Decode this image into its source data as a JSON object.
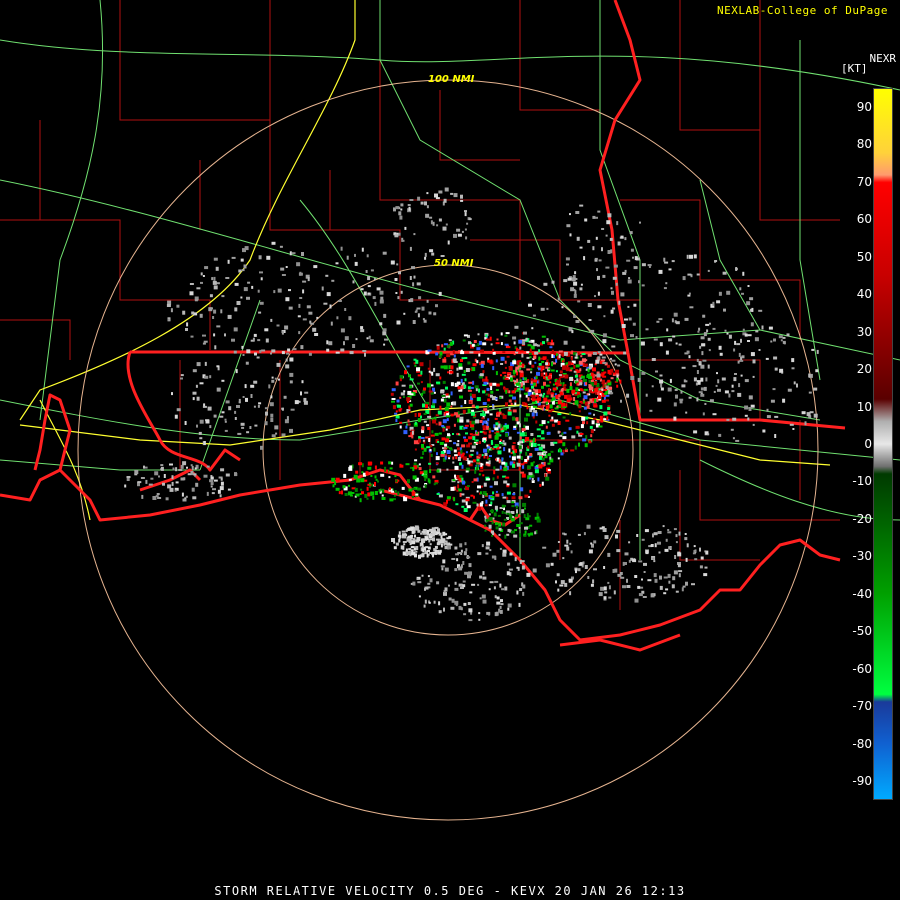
{
  "header": {
    "credit": "NEXLAB-College of DuPage",
    "product": "NEXR",
    "units": "[KT]"
  },
  "rings": {
    "outer_label": "100 NMI",
    "inner_label": "50 NMI"
  },
  "colorbar": {
    "ticks": [
      90,
      80,
      70,
      60,
      50,
      40,
      30,
      20,
      10,
      0,
      -10,
      -20,
      -30,
      -40,
      -50,
      -60,
      -70,
      -80,
      -90
    ],
    "range": [
      -95,
      95
    ],
    "stops": [
      {
        "v": 95,
        "color": "#ffff00"
      },
      {
        "v": 78,
        "color": "#ffd23a"
      },
      {
        "v": 72,
        "color": "#ff9a6e"
      },
      {
        "v": 70,
        "color": "#ff0000"
      },
      {
        "v": 45,
        "color": "#c80000"
      },
      {
        "v": 12,
        "color": "#5a0000"
      },
      {
        "v": 6,
        "color": "#b0b0b0"
      },
      {
        "v": 0,
        "color": "#e8e8e8"
      },
      {
        "v": -6,
        "color": "#707070"
      },
      {
        "v": -8,
        "color": "#003a00"
      },
      {
        "v": -40,
        "color": "#00a000"
      },
      {
        "v": -67,
        "color": "#00ff40"
      },
      {
        "v": -69,
        "color": "#1a3a9a"
      },
      {
        "v": -80,
        "color": "#1060d0"
      },
      {
        "v": -95,
        "color": "#00aaff"
      }
    ]
  },
  "colors": {
    "state_border": "#ff2020",
    "county": "#c01010",
    "highway": "#80ff80",
    "interstate": "#ffff40",
    "range_ring": "#ffc8a0"
  },
  "footer": {
    "caption": "STORM RELATIVE VELOCITY 0.5 DEG - KEVX 20 JAN 26 12:13"
  }
}
